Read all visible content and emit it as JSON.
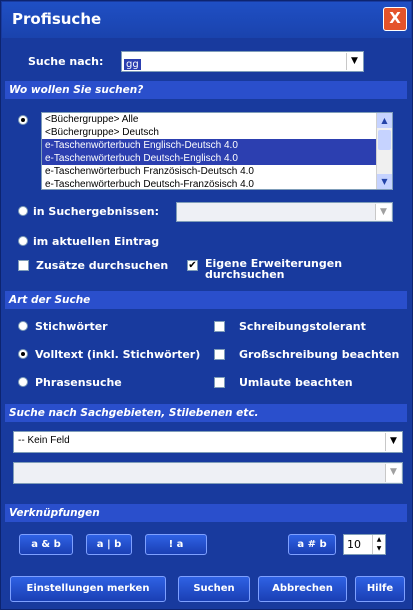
{
  "window": {
    "title": "Profisuche",
    "close_glyph": "X"
  },
  "search": {
    "label": "Suche nach:",
    "value": "gg",
    "dropdown_glyph": "▼"
  },
  "where": {
    "header": "Wo wollen Sie suchen?",
    "list_items": [
      "<Büchergruppe> Alle",
      "<Büchergruppe> Deutsch",
      "e-Taschenwörterbuch Englisch-Deutsch 4.0",
      "e-Taschenwörterbuch Deutsch-Englisch 4.0",
      "e-Taschenwörterbuch Französisch-Deutsch 4.0",
      "e-Taschenwörterbuch Deutsch-Französisch 4.0"
    ],
    "selected_items": [
      2,
      3
    ],
    "radio_results_label": "in Suchergebnissen:",
    "radio_current_label": "im aktuellen Eintrag",
    "check_additions_label": "Zusätze durchsuchen",
    "check_extensions_label": "Eigene Erweiterungen durchsuchen",
    "check_mark": "✔",
    "scroll_up": "▲",
    "scroll_down": "▼"
  },
  "kind": {
    "header": "Art der Suche",
    "radio_keywords": "Stichwörter",
    "radio_fulltext": "Volltext (inkl. Stichwörter)",
    "radio_phrase": "Phrasensuche",
    "check_spelling": "Schreibungstolerant",
    "check_case": "Großschreibung beachten",
    "check_umlauts": "Umlaute beachten"
  },
  "fields": {
    "header": "Suche nach Sachgebieten, Stilebenen etc.",
    "field_value": "-- Kein Feld"
  },
  "links": {
    "header": "Verknüpfungen",
    "and_label": "a & b",
    "or_label": "a | b",
    "not_label": "! a",
    "near_label": "a # b",
    "near_value": "10",
    "spin_up": "▲",
    "spin_down": "▼"
  },
  "footer": {
    "save_settings": "Einstellungen merken",
    "search": "Suchen",
    "cancel": "Abbrechen",
    "help": "Hilfe"
  }
}
